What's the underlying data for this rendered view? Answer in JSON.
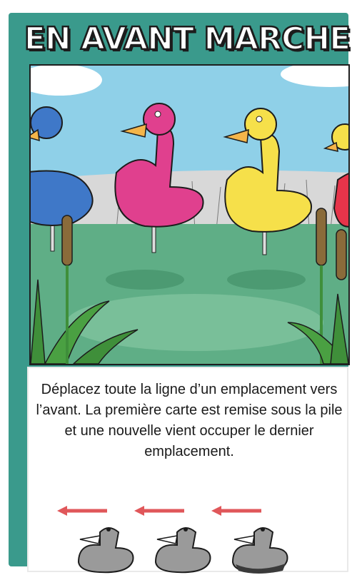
{
  "card": {
    "title": "EN AVANT MARCHE",
    "rules_text": "Déplacez toute la ligne d’un emplacement vers l’avant. La première carte est remise sous la pile et une nouvelle vient occuper le dernier emplacement."
  },
  "illustration": {
    "subject": "ducks-on-pond",
    "duck_colors": [
      "#3f78c8",
      "#e0408e",
      "#f6e04a",
      "#e6344a"
    ]
  },
  "legend": {
    "arrow_color": "#e0575a",
    "duck_color": "#9a9a9a"
  }
}
